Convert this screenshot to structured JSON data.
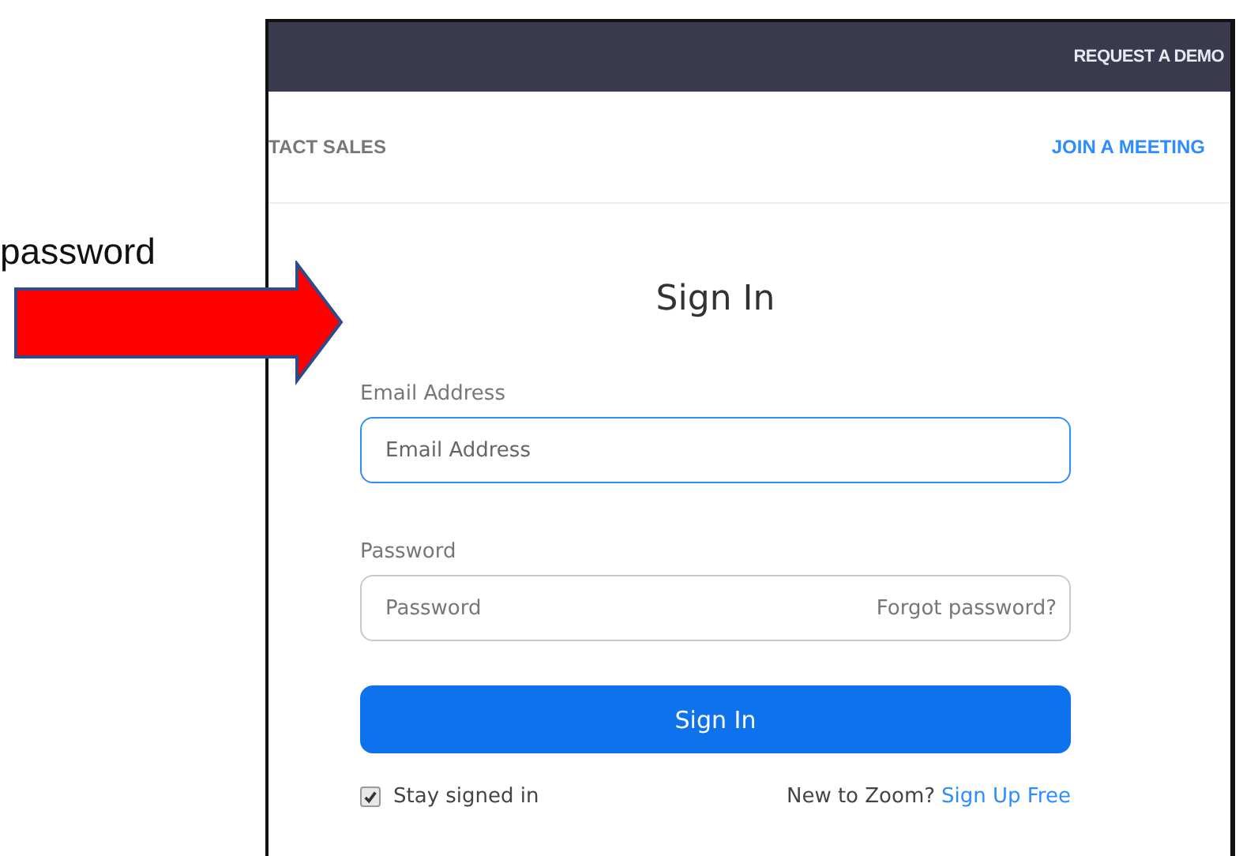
{
  "caption": "password",
  "top_bar": {
    "link": "REQUEST A DEMO"
  },
  "nav": {
    "left_link": "TACT SALES",
    "right_link": "JOIN A MEETING"
  },
  "form": {
    "title": "Sign In",
    "fields": [
      {
        "label": "Email Address",
        "placeholder": "Email Address",
        "focused": true
      },
      {
        "label": "Password",
        "placeholder": "Password",
        "focused": false,
        "action": "Forgot password?"
      }
    ],
    "submit": "Sign In",
    "remember": {
      "label": "Stay signed in",
      "checked": true
    },
    "signup": {
      "prompt": "New to Zoom?",
      "link": "Sign Up Free"
    }
  }
}
